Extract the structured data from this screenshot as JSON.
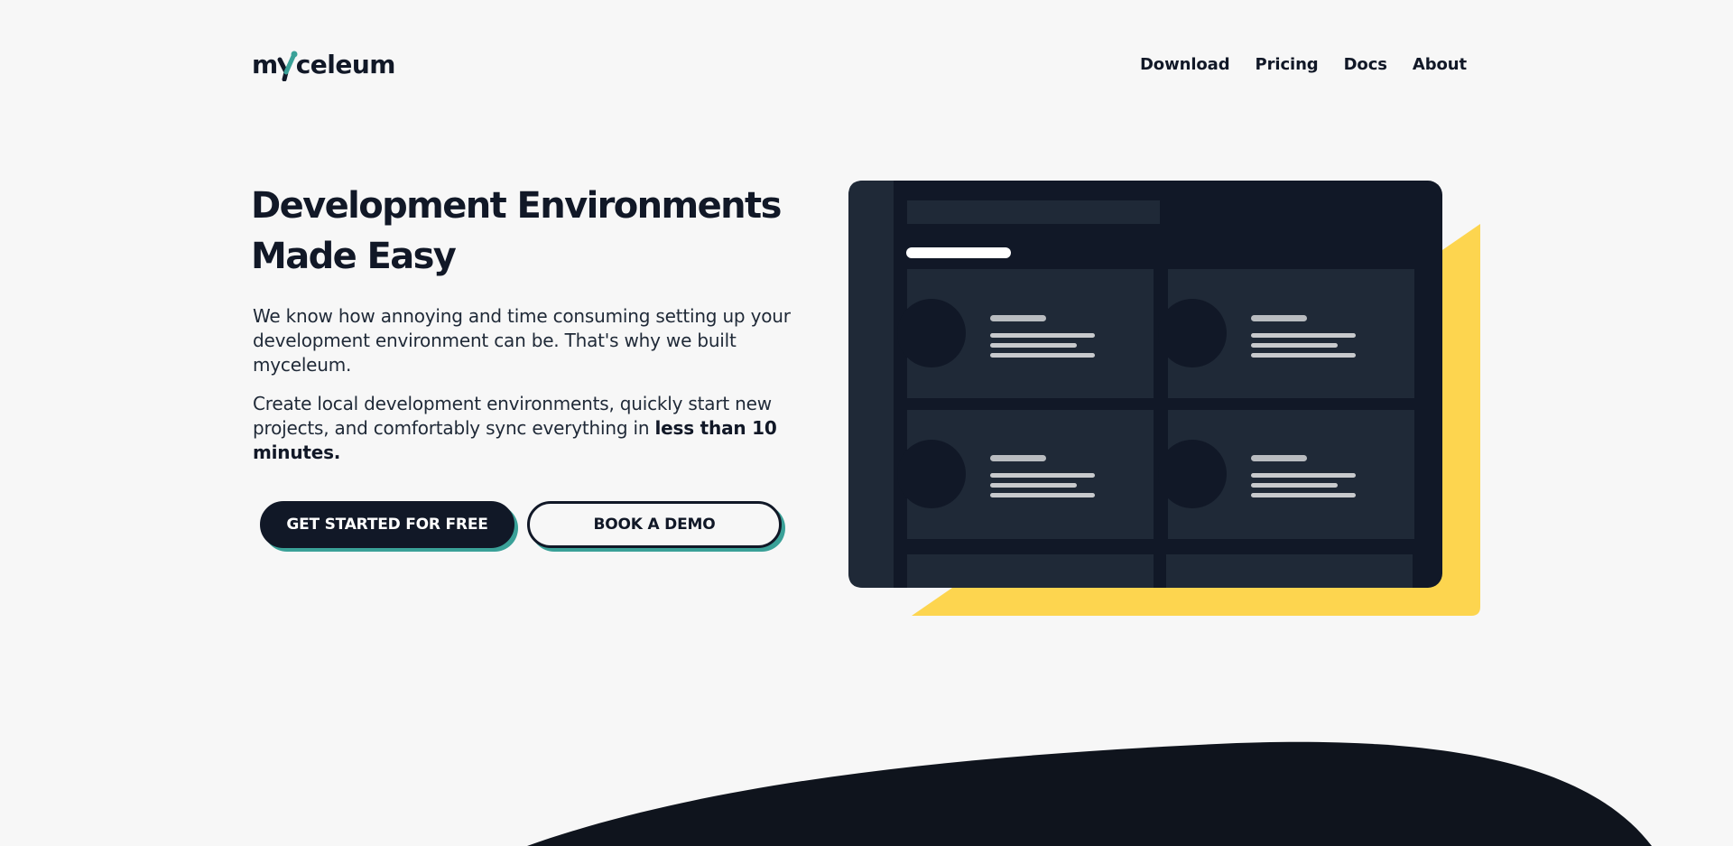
{
  "header": {
    "logo_text_left": "m",
    "logo_text_right": "celeum",
    "nav": [
      {
        "label": "Download"
      },
      {
        "label": "Pricing"
      },
      {
        "label": "Docs"
      },
      {
        "label": "About"
      }
    ]
  },
  "hero": {
    "title_line1": "Development Environments",
    "title_line2": "Made Easy",
    "paragraph1": "We know how annoying and time consuming setting up your development environment can be. That's why we built myceleum.",
    "paragraph2_prefix": "Create local development environments, quickly start new projects, and comfortably sync everything in ",
    "paragraph2_bold": "less than 10 minutes.",
    "primary_button": "GET STARTED FOR FREE",
    "secondary_button": "BOOK A DEMO"
  },
  "colors": {
    "background": "#f7f7f7",
    "dark": "#111827",
    "panel": "#1f2937",
    "accent_teal": "#3aa198",
    "accent_yellow": "#fcd34d"
  }
}
